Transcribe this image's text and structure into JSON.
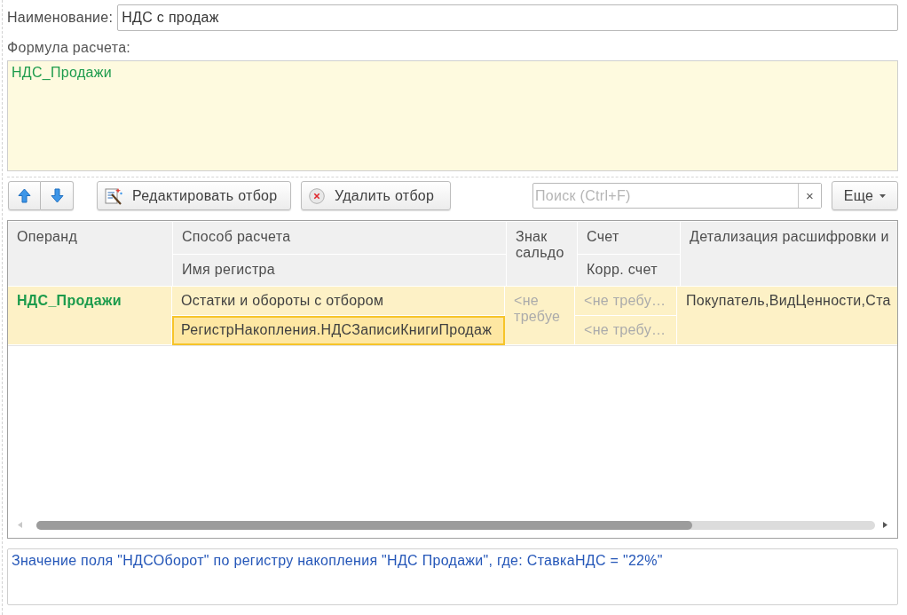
{
  "name_field": {
    "label": "Наименование:",
    "value": "НДС с продаж"
  },
  "formula": {
    "label": "Формула расчета:",
    "value": "НДС_Продажи"
  },
  "toolbar": {
    "move_buttons": [
      {
        "kind": "up"
      },
      {
        "kind": "down"
      }
    ],
    "buttons": [
      {
        "kind": "edit",
        "label": "Редактировать отбор"
      },
      {
        "kind": "delete",
        "label": "Удалить отбор"
      }
    ],
    "search": {
      "placeholder": "Поиск (Ctrl+F)",
      "clear": "×"
    },
    "more": {
      "label": "Еще"
    }
  },
  "table": {
    "columns": [
      {
        "title": "Операнд"
      },
      {
        "title": "Способ расчета",
        "subtitle": "Имя регистра"
      },
      {
        "title": "Знак сальдо"
      },
      {
        "title": "Счет",
        "subtitle": "Корр. счет"
      },
      {
        "title": "Детализация расшифровки и"
      }
    ],
    "rows": [
      {
        "selected": true,
        "operand": {
          "text": "НДС_Продажи"
        },
        "calculation_method": {
          "text": "Остатки и обороты с отбором"
        },
        "register_name": {
          "text": "РегистрНакопления.НДСЗаписиКнигиПродаж",
          "focused": true
        },
        "balance_sign": {
          "placeholder": "<не требуе"
        },
        "account": {
          "placeholder": "<не требу…"
        },
        "corr_account": {
          "placeholder": "<не требу…"
        },
        "detail": {
          "text": "Покупатель,ВидЦенности,Ста"
        }
      }
    ]
  },
  "description": "Значение поля \"НДСОборот\" по регистру накопления \"НДС Продажи\", где: СтавкаНДС = \"22%\""
}
